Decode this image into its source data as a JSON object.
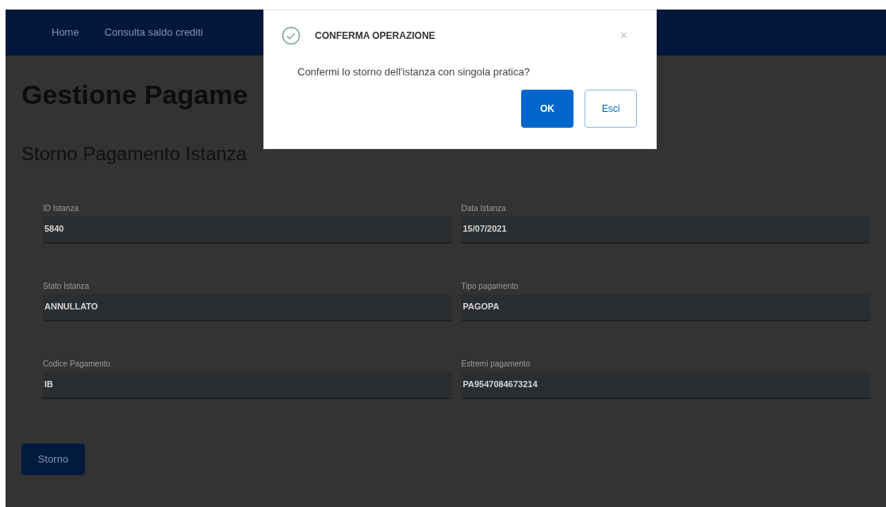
{
  "nav": {
    "items": [
      {
        "label": "Home"
      },
      {
        "label": "Consulta saldo crediti"
      }
    ]
  },
  "page": {
    "title": "Gestione Pagame",
    "subtitle": "Storno Pagamento Istanza"
  },
  "fields": [
    {
      "label": "ID Istanza",
      "value": "5840"
    },
    {
      "label": "Data Istanza",
      "value": "15/07/2021"
    },
    {
      "label": "Stato Istanza",
      "value": "ANNULLATO"
    },
    {
      "label": "Tipo pagamento",
      "value": "PAGOPA"
    },
    {
      "label": "Codice Pagamento",
      "value": "IB"
    },
    {
      "label": "Estremi pagamento",
      "value": "PA9547084673214"
    }
  ],
  "action_button": "Storno",
  "dialog": {
    "title": "CONFERMA OPERAZIONE",
    "close": "×",
    "message": "Confermi lo storno dell'istanza con singola pratica?",
    "buttons": [
      {
        "label": "OK",
        "kind": "primary"
      },
      {
        "label": "Esci",
        "kind": "secondary"
      }
    ]
  }
}
